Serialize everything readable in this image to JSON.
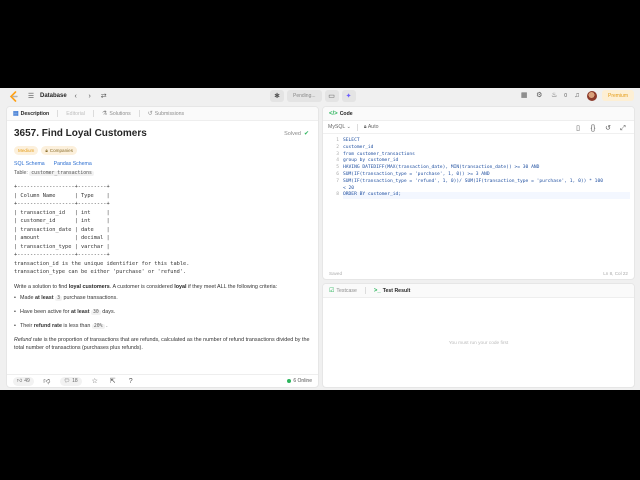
{
  "nav": {
    "title": "Database",
    "pending_label": "Pending...",
    "counter_value": "0",
    "premium_label": "Premium"
  },
  "left_tabs": {
    "description": "Description",
    "editorial": "Editorial",
    "solutions": "Solutions",
    "submissions": "Submissions"
  },
  "problem": {
    "title": "3657. Find Loyal Customers",
    "status": "Solved",
    "difficulty": "Medium",
    "companies_label": "Companies",
    "sql_schema_link": "SQL Schema",
    "pandas_schema_link": "Pandas Schema",
    "table_prefix": "Table:",
    "table_name": "customer_transactions",
    "schema_text": "+------------------+---------+\n| Column Name      | Type    |\n+------------------+---------+\n| transaction_id   | int     |\n| customer_id      | int     |\n| transaction_date | date    |\n| amount           | decimal |\n| transaction_type | varchar |\n+------------------+---------+\ntransaction_id is the unique identifier for this table.\ntransaction_type can be either 'purchase' or 'refund'.",
    "task_intro": "Write a solution to find ",
    "task_bold1": "loyal customers",
    "task_mid": ". A customer is considered ",
    "task_bold2": "loyal",
    "task_end": " if they meet ALL the following criteria:",
    "criteria": [
      {
        "pre": "Made ",
        "bold": "at least",
        "code": "3",
        "post": " purchase transactions."
      },
      {
        "pre": "Have been active for ",
        "bold": "at least",
        "code": "30",
        "post": " days."
      },
      {
        "pre": "Their ",
        "bold": "refund rate",
        "code": "20%",
        "post": " is less than ",
        "order": "post-then-code"
      }
    ],
    "refund_term": "Refund rate",
    "refund_def": " is the proportion of transactions that are refunds, calculated as the number of refund transactions divided by the total number of transactions (purchases plus refunds)."
  },
  "footer": {
    "likes": "49",
    "comments": "18",
    "online": "6 Online"
  },
  "code_panel": {
    "tab_label": "Code",
    "language": "MySQL",
    "auto_label": "Auto",
    "lines": [
      "SELECT",
      "customer_id",
      "from customer_transactions",
      "group by customer_id",
      "HAVING DATEDIFF(MAX(transaction_date), MIN(transaction_date)) >= 30 AND",
      "SUM(IF(transaction_type = 'purchase', 1, 0)) >= 3 AND",
      "SUM(IF(transaction_type = 'refund', 1, 0))/ SUM(IF(transaction_type = 'purchase', 1, 0)) * 100",
      "< 20",
      "ORDER BY customer_id;"
    ],
    "line_numbers": [
      "1",
      "2",
      "3",
      "4",
      "5",
      "6",
      "7",
      "",
      "8"
    ],
    "saved_label": "Saved",
    "cursor_pos": "Ln 8, Col 22"
  },
  "test_panel": {
    "testcase_label": "Testcase",
    "result_label": "Test Result",
    "empty_message": "You must run your code first"
  }
}
